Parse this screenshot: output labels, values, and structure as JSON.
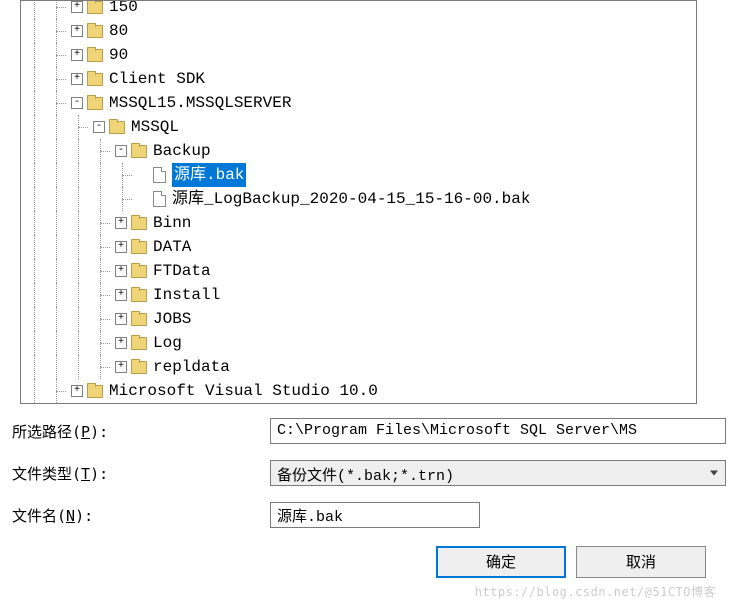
{
  "tree": {
    "nodes": [
      {
        "depth": 2,
        "expander": "+",
        "icon": "folder",
        "label": "150"
      },
      {
        "depth": 2,
        "expander": "+",
        "icon": "folder",
        "label": "80"
      },
      {
        "depth": 2,
        "expander": "+",
        "icon": "folder",
        "label": "90"
      },
      {
        "depth": 2,
        "expander": "+",
        "icon": "folder",
        "label": "Client SDK"
      },
      {
        "depth": 2,
        "expander": "-",
        "icon": "folder",
        "label": "MSSQL15.MSSQLSERVER"
      },
      {
        "depth": 3,
        "expander": "-",
        "icon": "folder",
        "label": "MSSQL"
      },
      {
        "depth": 4,
        "expander": "-",
        "icon": "folder",
        "label": "Backup"
      },
      {
        "depth": 5,
        "expander": "",
        "icon": "file",
        "label": "源库.bak",
        "selected": true
      },
      {
        "depth": 5,
        "expander": "",
        "icon": "file",
        "label": "源库_LogBackup_2020-04-15_15-16-00.bak"
      },
      {
        "depth": 4,
        "expander": "+",
        "icon": "folder",
        "label": "Binn"
      },
      {
        "depth": 4,
        "expander": "+",
        "icon": "folder",
        "label": "DATA"
      },
      {
        "depth": 4,
        "expander": "+",
        "icon": "folder",
        "label": "FTData"
      },
      {
        "depth": 4,
        "expander": "+",
        "icon": "folder",
        "label": "Install"
      },
      {
        "depth": 4,
        "expander": "+",
        "icon": "folder",
        "label": "JOBS"
      },
      {
        "depth": 4,
        "expander": "+",
        "icon": "folder",
        "label": "Log"
      },
      {
        "depth": 4,
        "expander": "+",
        "icon": "folder",
        "label": "repldata"
      },
      {
        "depth": 2,
        "expander": "+",
        "icon": "folder",
        "label": "Microsoft Visual Studio 10.0",
        "cutoff": true
      }
    ]
  },
  "form": {
    "path_label_pre": "所选路径(",
    "path_label_key": "P",
    "path_label_post": "):",
    "path_value": "C:\\Program Files\\Microsoft SQL Server\\MS",
    "type_label_pre": "文件类型(",
    "type_label_key": "T",
    "type_label_post": "):",
    "type_value": "备份文件(*.bak;*.trn)",
    "name_label_pre": "文件名(",
    "name_label_key": "N",
    "name_label_post": "):",
    "name_value": "源库.bak"
  },
  "buttons": {
    "ok": "确定",
    "cancel": "取消"
  },
  "watermark": "https://blog.csdn.net/@51CTO博客"
}
